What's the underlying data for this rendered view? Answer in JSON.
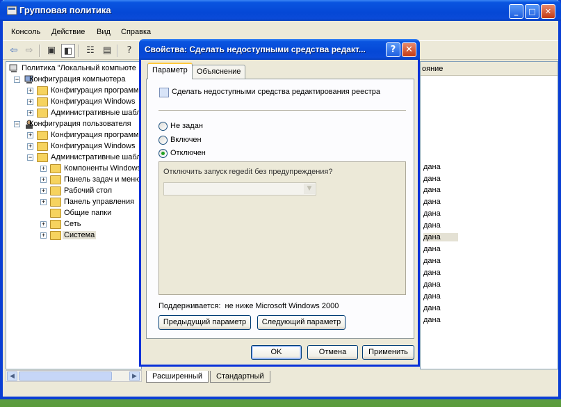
{
  "main_window": {
    "title": "Групповая политика",
    "menu": [
      "Консоль",
      "Действие",
      "Вид",
      "Справка"
    ]
  },
  "tree": {
    "root": "Политика \"Локальный компьюте",
    "nodes": [
      {
        "label": "Конфигурация компьютера"
      },
      {
        "label": "Конфигурация программ"
      },
      {
        "label": "Конфигурация Windows"
      },
      {
        "label": "Административные шабл"
      },
      {
        "label": "Конфигурация пользователя"
      },
      {
        "label": "Конфигурация программ"
      },
      {
        "label": "Конфигурация Windows"
      },
      {
        "label": "Административные шабл"
      },
      {
        "label": "Компоненты Windows"
      },
      {
        "label": "Панель задач и меню"
      },
      {
        "label": "Рабочий стол"
      },
      {
        "label": "Панель управления"
      },
      {
        "label": "Общие папки"
      },
      {
        "label": "Сеть"
      },
      {
        "label": "Система"
      }
    ]
  },
  "right_pane": {
    "column_header": "ояние",
    "values": [
      "дана",
      "дана",
      "дана",
      "дана",
      "дана",
      "дана",
      "дана",
      "дана",
      "дана",
      "дана",
      "дана",
      "дана",
      "дана",
      "дана"
    ]
  },
  "bottom_tabs": [
    "Расширенный",
    "Стандартный"
  ],
  "dialog": {
    "title": "Свойства: Сделать недоступными средства редакт...",
    "tabs": [
      "Параметр",
      "Объяснение"
    ],
    "setting_name": "Сделать недоступными средства редактирования реестра",
    "radio_options": [
      {
        "label": "Не задан",
        "selected": false
      },
      {
        "label": "Включен",
        "selected": false
      },
      {
        "label": "Отключен",
        "selected": true
      }
    ],
    "option_question": "Отключить запуск regedit без предупреждения?",
    "option_value": "",
    "supported_label": "Поддерживается:",
    "supported_value": "не ниже Microsoft Windows 2000",
    "prev_button": "Предыдущий параметр",
    "next_button": "Следующий параметр",
    "ok": "OK",
    "cancel": "Отмена",
    "apply": "Применить"
  },
  "colors": {
    "title_blue": "#0548d6",
    "face": "#ece9d8",
    "radio_dot": "#21a121"
  }
}
